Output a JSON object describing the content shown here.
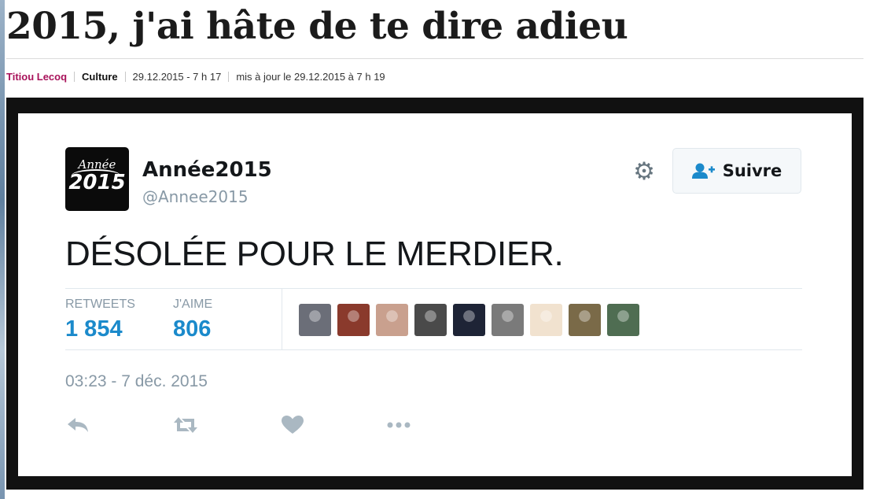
{
  "article": {
    "title": "2015, j'ai hâte de te dire adieu",
    "author": "Titiou Lecoq",
    "category": "Culture",
    "published": "29.12.2015 - 7 h 17",
    "updated": "mis à jour le 29.12.2015 à 7 h 19"
  },
  "tweet": {
    "avatar_top": "Année",
    "avatar_bottom": "2015",
    "display_name": "Année2015",
    "handle": "@Annee2015",
    "follow_label": "Suivre",
    "text": "DÉSOLÉE POUR LE MERDIER.",
    "stats": {
      "retweets_label": "RETWEETS",
      "retweets_value": "1 854",
      "likes_label": "J'AIME",
      "likes_value": "806"
    },
    "likers_count_shown": 9,
    "liker_colors": [
      "#6b6e78",
      "#8a3a2c",
      "#c9a08e",
      "#4a4a4a",
      "#1e2436",
      "#7a7a7a",
      "#f1e2cf",
      "#7a6a48",
      "#4f6d52"
    ],
    "timestamp": "03:23 - 7 déc. 2015",
    "actions": [
      "reply-icon",
      "retweet-icon",
      "heart-icon",
      "more-icon"
    ]
  },
  "colors": {
    "author": "#a8125a",
    "stat_value": "#1b8acb",
    "muted": "#8899a6",
    "frame": "#111111"
  }
}
